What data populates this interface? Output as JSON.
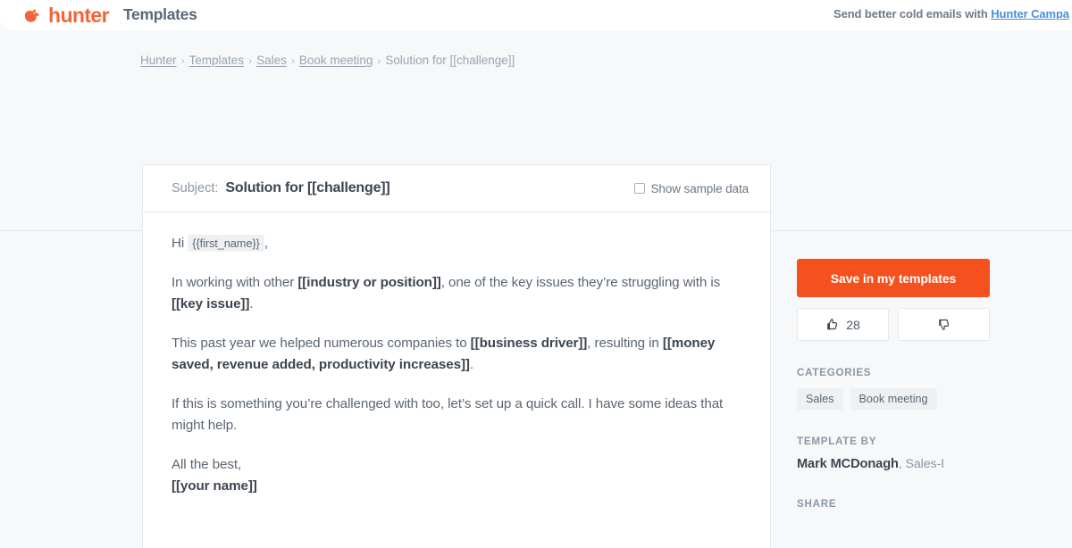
{
  "header": {
    "brand_name": "hunter",
    "section_title": "Templates",
    "promo_prefix": "Send better cold emails with ",
    "promo_link": "Hunter Campa",
    "logo_icon": "hunter-bird-logo"
  },
  "breadcrumb": {
    "items": [
      {
        "label": "Hunter",
        "is_link": true
      },
      {
        "label": "Templates",
        "is_link": true
      },
      {
        "label": "Sales",
        "is_link": true
      },
      {
        "label": "Book meeting",
        "is_link": true
      },
      {
        "label": "Solution for [[challenge]]",
        "is_link": false
      }
    ],
    "separator": "›"
  },
  "email_card": {
    "subject_label": "Subject:",
    "subject_value": "Solution for [[challenge]]",
    "sample_data_label": "Show sample data",
    "sample_data_checked": false,
    "greeting": {
      "prefix": "Hi",
      "token": "{{first_name}}",
      "suffix": ","
    },
    "paragraph_2": {
      "part1": "In working with other ",
      "bold1": "[[industry or position]]",
      "part2": ", one of the key issues they’re struggling with is ",
      "bold2": "[[key issue]]",
      "part3": "."
    },
    "paragraph_3": {
      "part1": "This past year we helped numerous companies to ",
      "bold1": "[[business driver]]",
      "part2": ", resulting in ",
      "bold2": "[[money saved, revenue added, productivity increases]]",
      "part3": "."
    },
    "paragraph_4": "If this is something you’re challenged with too, let’s set up a quick call. I have some ideas that might help.",
    "signoff": "All the best,",
    "signature": "[[your name]]"
  },
  "rail": {
    "save_button": "Save in my templates",
    "upvote_count": "28",
    "upvote_icon": "thumbs-up-icon",
    "downvote_icon": "thumbs-down-icon",
    "categories_heading": "CATEGORIES",
    "categories": [
      "Sales",
      "Book meeting"
    ],
    "template_by_heading": "TEMPLATE BY",
    "author_name": "Mark MCDonagh",
    "author_role": ", Sales-I",
    "share_heading": "SHARE"
  },
  "colors": {
    "brand_orange": "#f4511e",
    "logo_orange": "#f3643a",
    "link_blue": "#4a90d9",
    "page_bg": "#f6f8f9",
    "text_muted": "#8b97a4",
    "text_body": "#5a6672",
    "text_strong": "#3c4650"
  }
}
